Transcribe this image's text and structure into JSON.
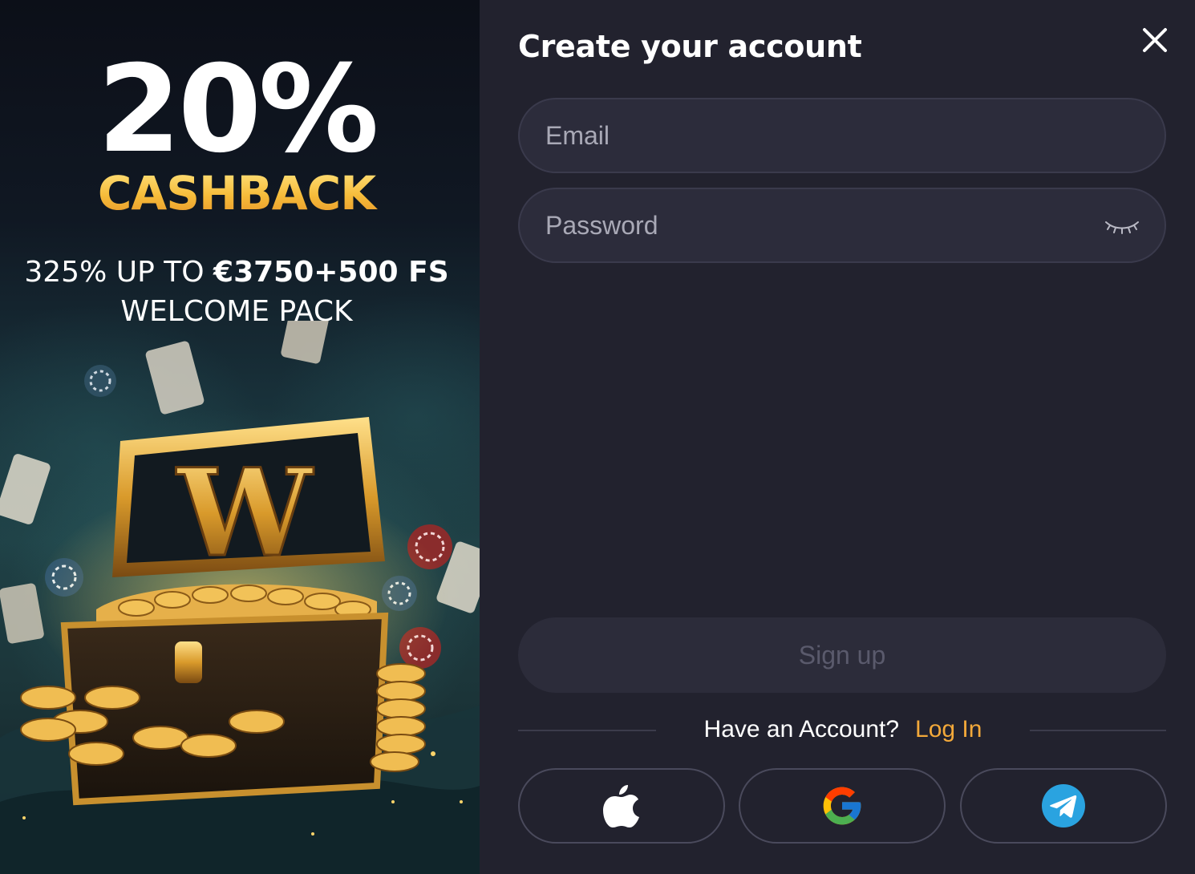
{
  "promo": {
    "headline": "20%",
    "subheadline": "CASHBACK",
    "offer_part1": "325% UP TO ",
    "offer_part2": "€3750+500 FS",
    "offer_line2": "WELCOME PACK",
    "chest_letter": "W"
  },
  "form": {
    "title": "Create your account",
    "email_placeholder": "Email",
    "password_placeholder": "Password",
    "signup_label": "Sign up",
    "have_account_text": "Have an Account?",
    "login_label": "Log In"
  },
  "social": {
    "apple_icon": "apple-icon",
    "google_icon": "google-icon",
    "telegram_icon": "telegram-icon"
  },
  "colors": {
    "background": "#22222e",
    "field_bg": "#2c2c3b",
    "accent_gold": "#f6bc3a",
    "login_link": "#f3a93a",
    "telegram_blue": "#2aa3e0"
  }
}
